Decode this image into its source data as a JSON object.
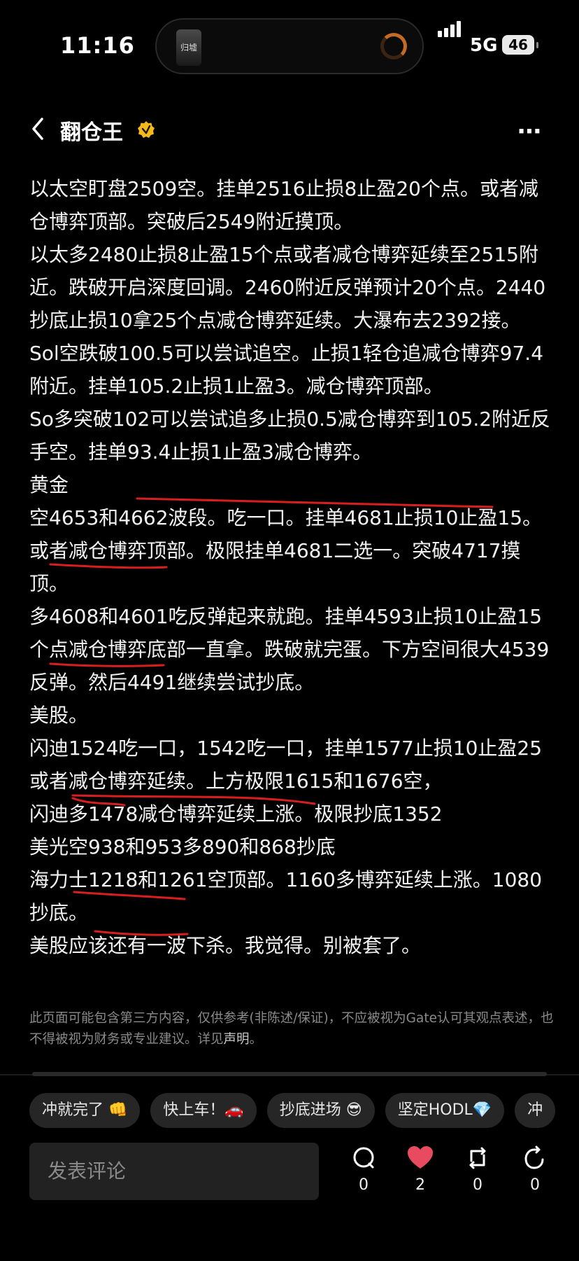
{
  "status_bar": {
    "time": "11:16",
    "network": "5G",
    "battery": "46",
    "island_cover_text": "归墟"
  },
  "header": {
    "title": "翻仓王",
    "verified_icon": "verified-badge-icon",
    "more_icon": "more-icon",
    "back_icon": "back-chevron-icon"
  },
  "article": {
    "paragraphs": [
      "以太空盯盘2509空。挂单2516止损8止盈20个点。或者减仓博弈顶部。突破后2549附近摸顶。",
      "以太多2480止损8止盈15个点或者减仓博弈延续至2515附近。跌破开启深度回调。2460附近反弹预计20个点。2440抄底止损10拿25个点减仓博弈延续。大瀑布去2392接。",
      "Sol空跌破100.5可以尝试追空。止损1轻仓追减仓博弈97.4附近。挂单105.2止损1止盈3。减仓博弈顶部。",
      "So多突破102可以尝试追多止损0.5减仓博弈到105.2附近反手空。挂单93.4止损1止盈3减仓博弈。",
      "黄金",
      "空4653和4662波段。吃一口。挂单4681止损10止盈15。或者减仓博弈顶部。极限挂单4681二选一。突破4717摸顶。",
      "多4608和4601吃反弹起来就跑。挂单4593止损10止盈15个点减仓博弈底部一直拿。跌破就完蛋。下方空间很大4539反弹。然后4491继续尝试抄底。",
      "美股。",
      "闪迪1524吃一口，1542吃一口，挂单1577止损10止盈25或者减仓博弈延续。上方极限1615和1676空，",
      "闪迪多1478减仓博弈延续上涨。极限抄底1352",
      "美光空938和953多890和868抄底",
      "海力士1218和1261空顶部。1160多博弈延续上涨。1080抄底。",
      "美股应该还有一波下杀。我觉得。别被套了。"
    ],
    "disclaimer": "此页面可能包含第三方内容，仅供参考(非陈述/保证)，不应被视为Gate认可其观点表述，也不得被视为财务或专业建议。详见",
    "disclaimer_link": "声明",
    "disclaimer_end": "。"
  },
  "chips": [
    "冲就完了 👊",
    "快上车！🚗",
    "抄底进场 😎",
    "坚定HODL💎",
    "冲"
  ],
  "bottom_bar": {
    "comment_placeholder": "发表评论",
    "comments": "0",
    "likes": "2",
    "reposts": "0",
    "shares": "0",
    "like_color": "#e84a5f"
  }
}
